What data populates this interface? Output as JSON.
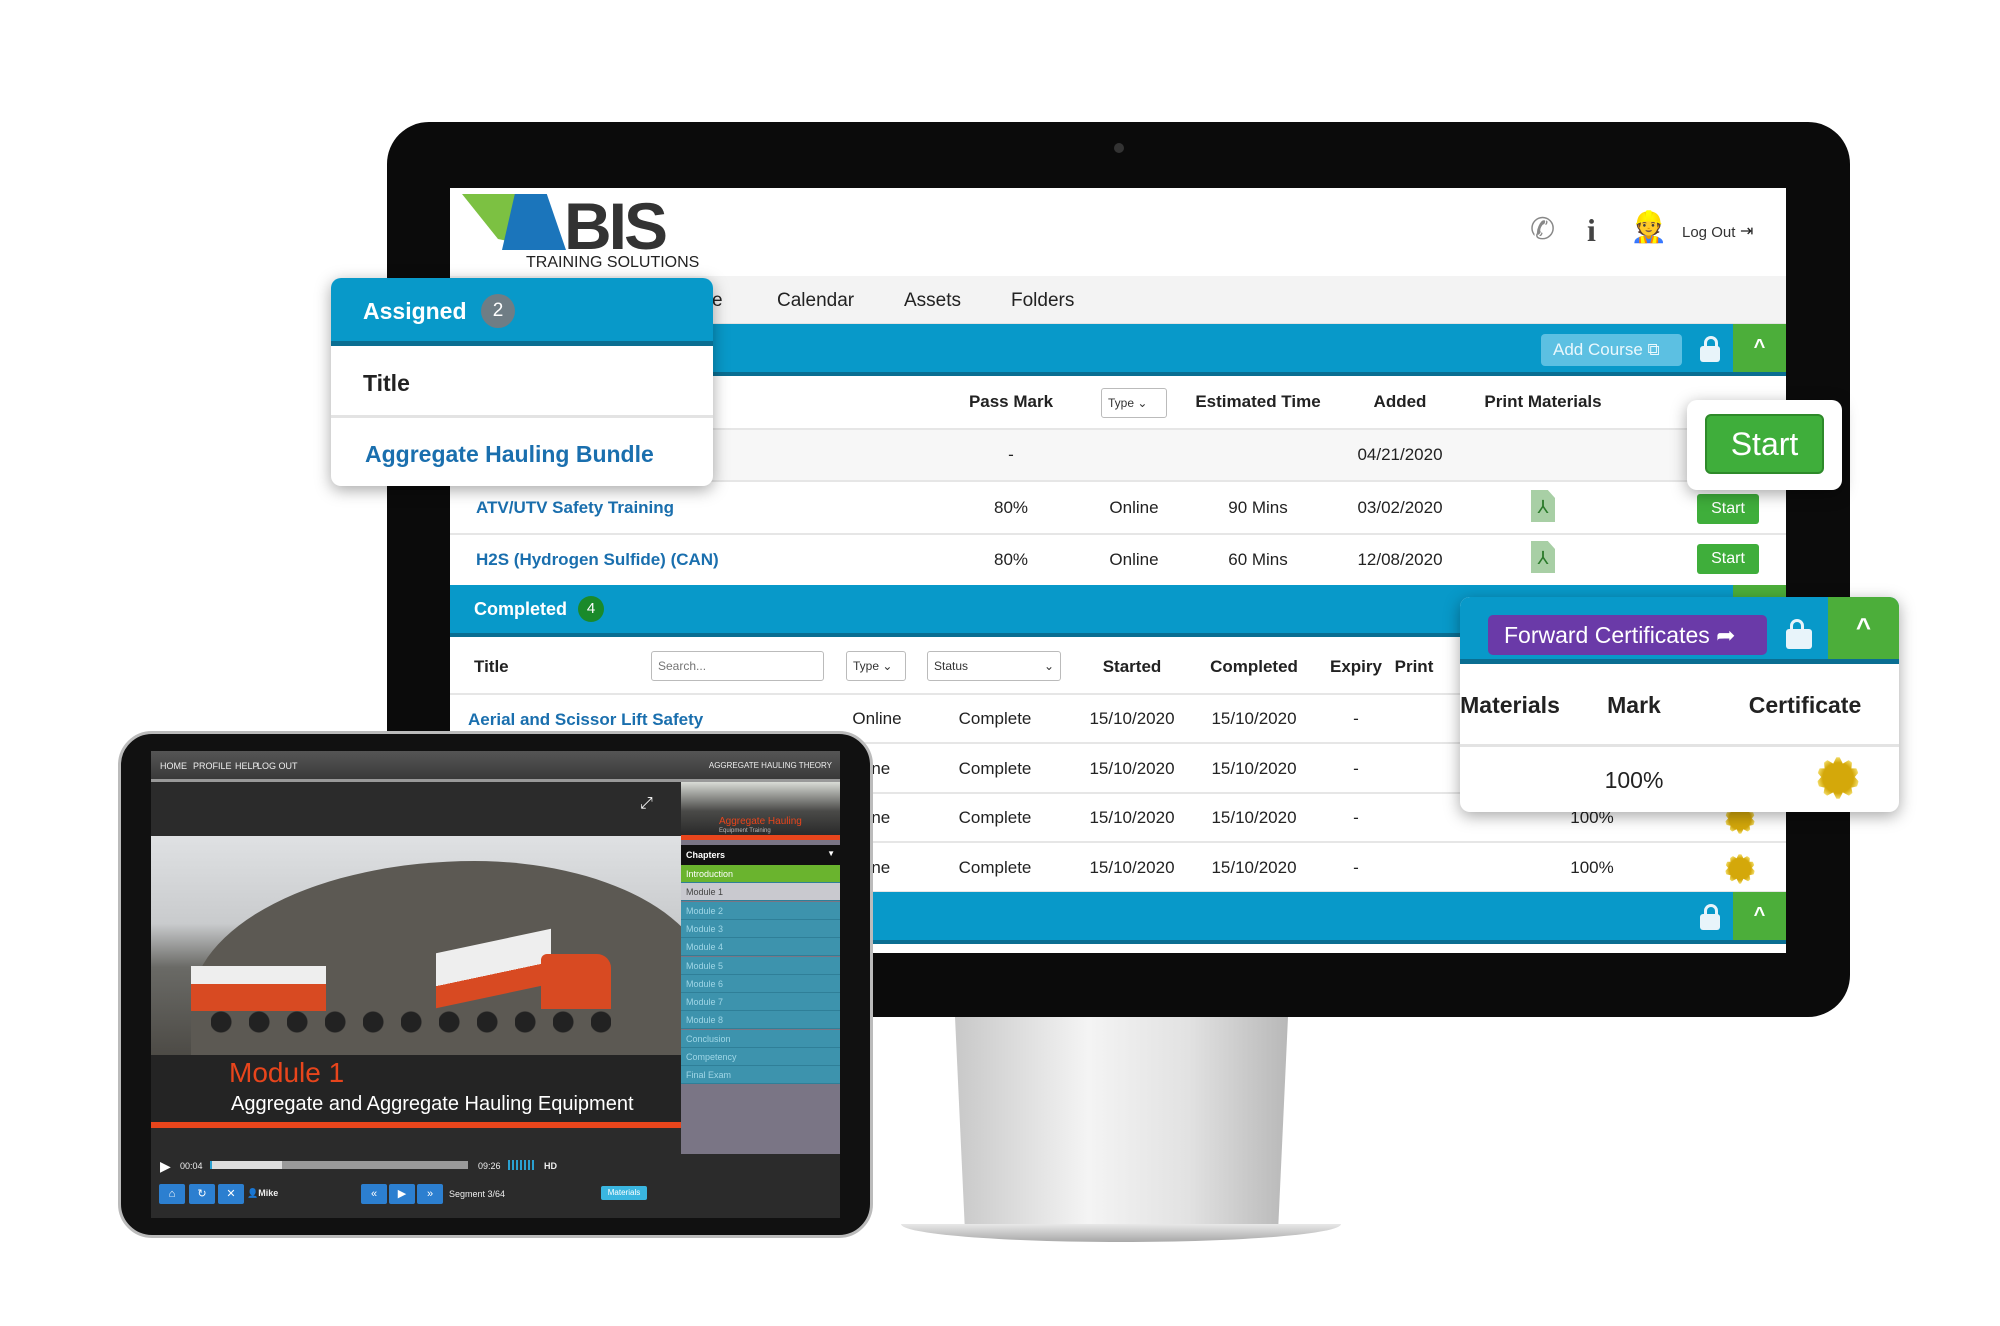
{
  "brand": {
    "logo_text": "BIS",
    "logo_sub": "TRAINING SOLUTIONS",
    "accent": "#0899c9",
    "green": "#4cae3a",
    "purple": "#6a3aa8"
  },
  "header": {
    "icons": [
      "phone-icon",
      "info-icon",
      "worker-avatar-icon"
    ],
    "logout": "Log Out"
  },
  "nav": {
    "partial": "e",
    "items": [
      "Calendar",
      "Assets",
      "Folders"
    ]
  },
  "assigned": {
    "label": "Assigned",
    "count": "2",
    "add_course": "Add Course",
    "columns": {
      "title": "Title",
      "pass_mark": "Pass Mark",
      "type": "Type",
      "estimated_time": "Estimated Time",
      "added": "Added",
      "print_materials": "Print Materials"
    },
    "rows": [
      {
        "title": "Aggregate Hauling Bundle",
        "pass_mark": "-",
        "type": "",
        "time": "",
        "added": "04/21/2020",
        "start": "Start"
      },
      {
        "title": "ATV/UTV Safety Training",
        "pass_mark": "80%",
        "type": "Online",
        "time": "90 Mins",
        "added": "03/02/2020",
        "start": "Start"
      },
      {
        "title": "H2S (Hydrogen Sulfide) (CAN)",
        "pass_mark": "80%",
        "type": "Online",
        "time": "60 Mins",
        "added": "12/08/2020",
        "start": "Start"
      }
    ]
  },
  "completed": {
    "label": "Completed",
    "count": "4",
    "forward": "Forward Certificates",
    "search_placeholder": "Search...",
    "columns": {
      "title": "Title",
      "type": "Type",
      "status": "Status",
      "started": "Started",
      "completed": "Completed",
      "expiry": "Expiry",
      "print": "Print",
      "materials": "Materials",
      "mark": "Mark",
      "certificate": "Certificate"
    },
    "rows": [
      {
        "title": "Aerial and Scissor Lift Safety",
        "type": "Online",
        "status": "Complete",
        "started": "15/10/2020",
        "completed": "15/10/2020",
        "expiry": "-",
        "mark": "100%"
      },
      {
        "type": "line",
        "status": "Complete",
        "started": "15/10/2020",
        "completed": "15/10/2020",
        "expiry": "-",
        "mark": "100%"
      },
      {
        "type": "line",
        "status": "Complete",
        "started": "15/10/2020",
        "completed": "15/10/2020",
        "expiry": "-",
        "mark": "100%"
      },
      {
        "type": "line",
        "status": "Complete",
        "started": "15/10/2020",
        "completed": "15/10/2020",
        "expiry": "-",
        "mark": "100%"
      }
    ]
  },
  "start_big": "Start",
  "player": {
    "menu": [
      "HOME",
      "PROFILE",
      "HELP",
      "LOG OUT"
    ],
    "course_title": "AGGREGATE HAULING THEORY",
    "thumb_title": "Aggregate Hauling",
    "thumb_sub": "Equipment Training",
    "chapters_label": "Chapters",
    "chapters": [
      "Introduction",
      "Module 1",
      "Module 2",
      "Module 3",
      "Module 4",
      "Module 5",
      "Module 6",
      "Module 7",
      "Module 8",
      "Conclusion",
      "Competency",
      "Final Exam"
    ],
    "module_title": "Module 1",
    "module_subtitle": "Aggregate and Aggregate Hauling Equipment",
    "current_time": "00:04",
    "duration": "09:26",
    "progress": 0.28,
    "hd": "HD",
    "user": "Mike",
    "segment": "Segment 3/64",
    "materials": "Materials"
  }
}
